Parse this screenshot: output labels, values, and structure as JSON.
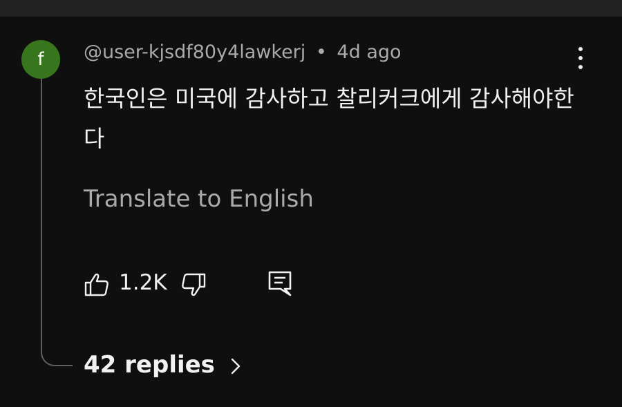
{
  "comment": {
    "avatar_letter": "f",
    "avatar_color": "#38761d",
    "author": "@user-kjsdf80y4lawkerj",
    "separator": "•",
    "time": "4d ago",
    "text": "한국인은 미국에 감사하고 찰리커크에게 감사해야한다",
    "translate_label": "Translate to English",
    "likes": "1.2K",
    "replies_label": "42 replies",
    "icons": [
      "more-vert-icon",
      "thumb-up-icon",
      "thumb-down-icon",
      "reply-icon",
      "chevron-right-icon"
    ]
  }
}
